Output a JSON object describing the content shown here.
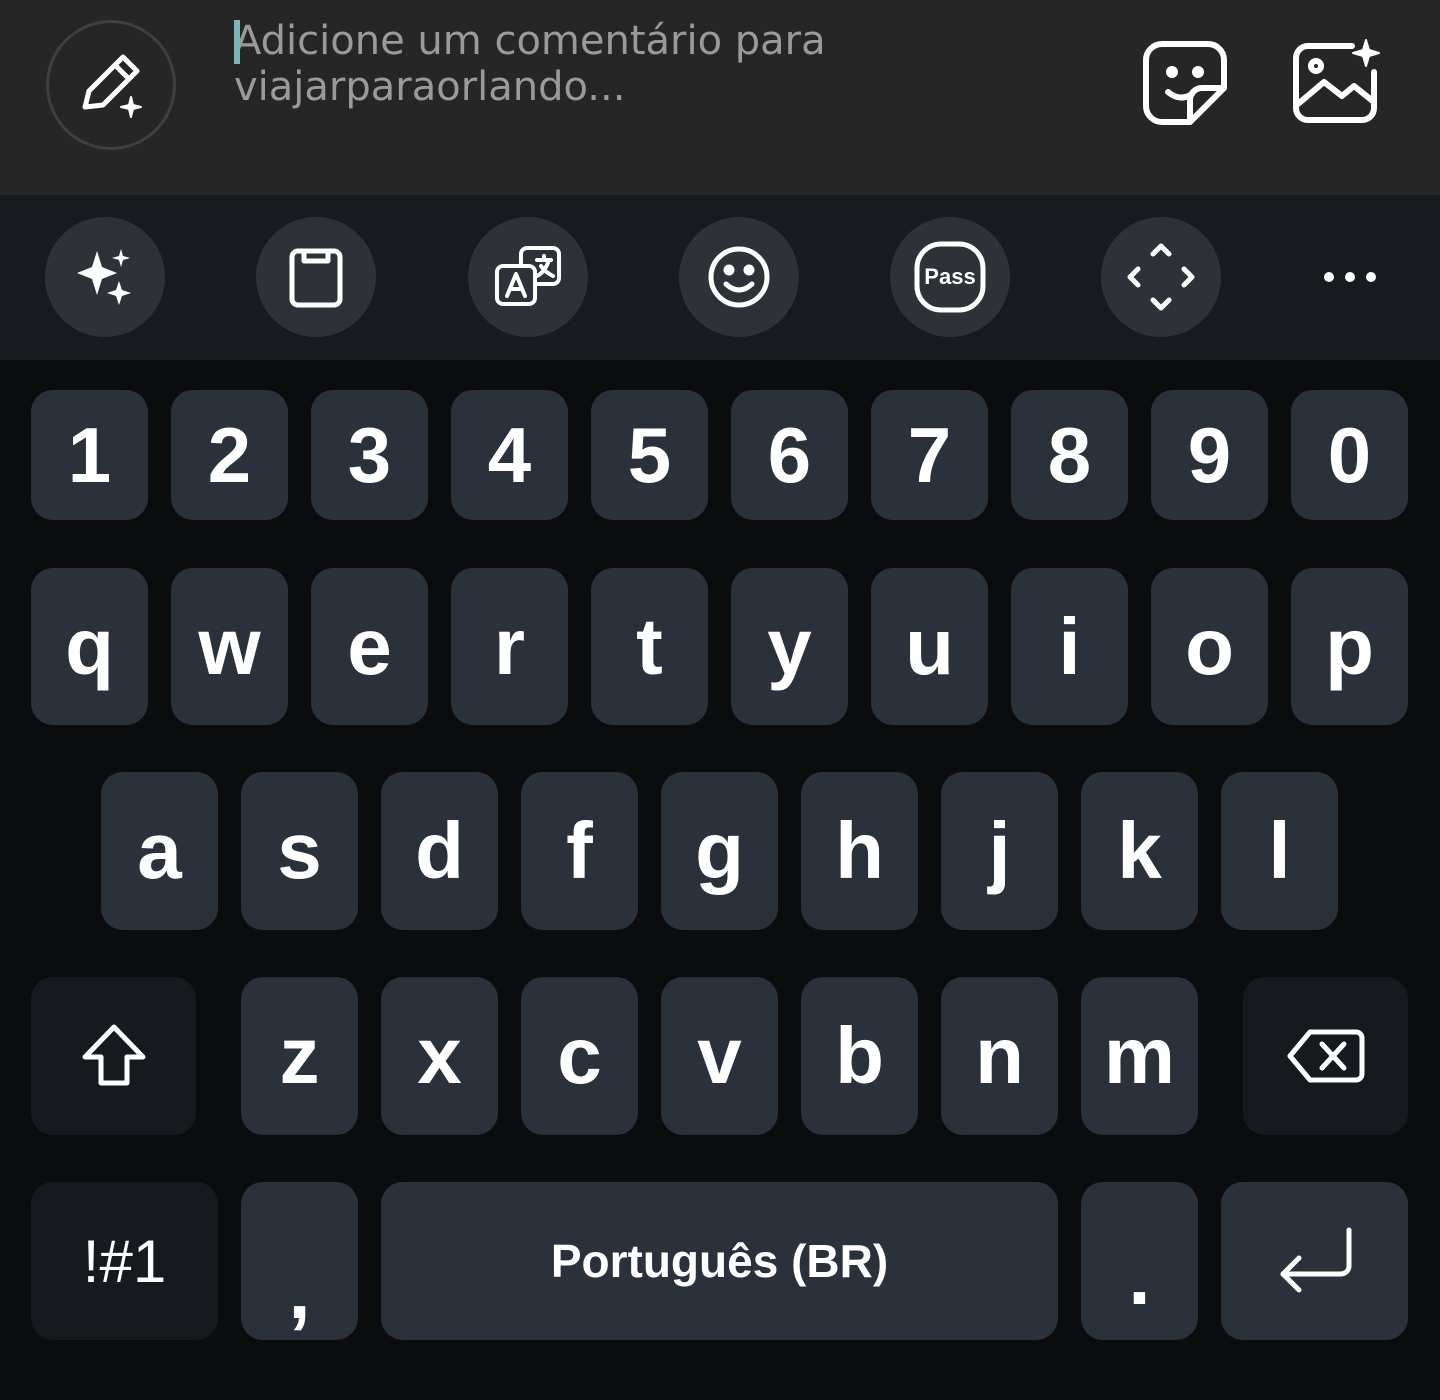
{
  "composer": {
    "placeholder_line1": "Adicione um comentário para",
    "placeholder_line2": "viajarparaorlando...",
    "icons": {
      "ai_edit": "pencil-sparkle-icon",
      "sticker": "sticker-icon",
      "image": "image-sparkle-icon"
    }
  },
  "toolbar": {
    "items": [
      {
        "name": "ai-sparkles-icon"
      },
      {
        "name": "clipboard-icon"
      },
      {
        "name": "translate-icon"
      },
      {
        "name": "emoji-icon"
      },
      {
        "name": "pass-icon",
        "label": "Pass"
      },
      {
        "name": "resize-keyboard-icon"
      },
      {
        "name": "more-icon"
      }
    ]
  },
  "keyboard": {
    "number_row": [
      "1",
      "2",
      "3",
      "4",
      "5",
      "6",
      "7",
      "8",
      "9",
      "0"
    ],
    "row1": [
      "q",
      "w",
      "e",
      "r",
      "t",
      "y",
      "u",
      "i",
      "o",
      "p"
    ],
    "row2": [
      "a",
      "s",
      "d",
      "f",
      "g",
      "h",
      "j",
      "k",
      "l"
    ],
    "row3": [
      "z",
      "x",
      "c",
      "v",
      "b",
      "n",
      "m"
    ],
    "symbols_label": "!#1",
    "comma_label": ",",
    "space_label": "Português (BR)",
    "period_label": ".",
    "colors": {
      "key": "#2b313b",
      "func_key": "#161a1f",
      "background": "#0b0c0d",
      "toolbar": "#171b20",
      "composer": "#262626"
    }
  }
}
